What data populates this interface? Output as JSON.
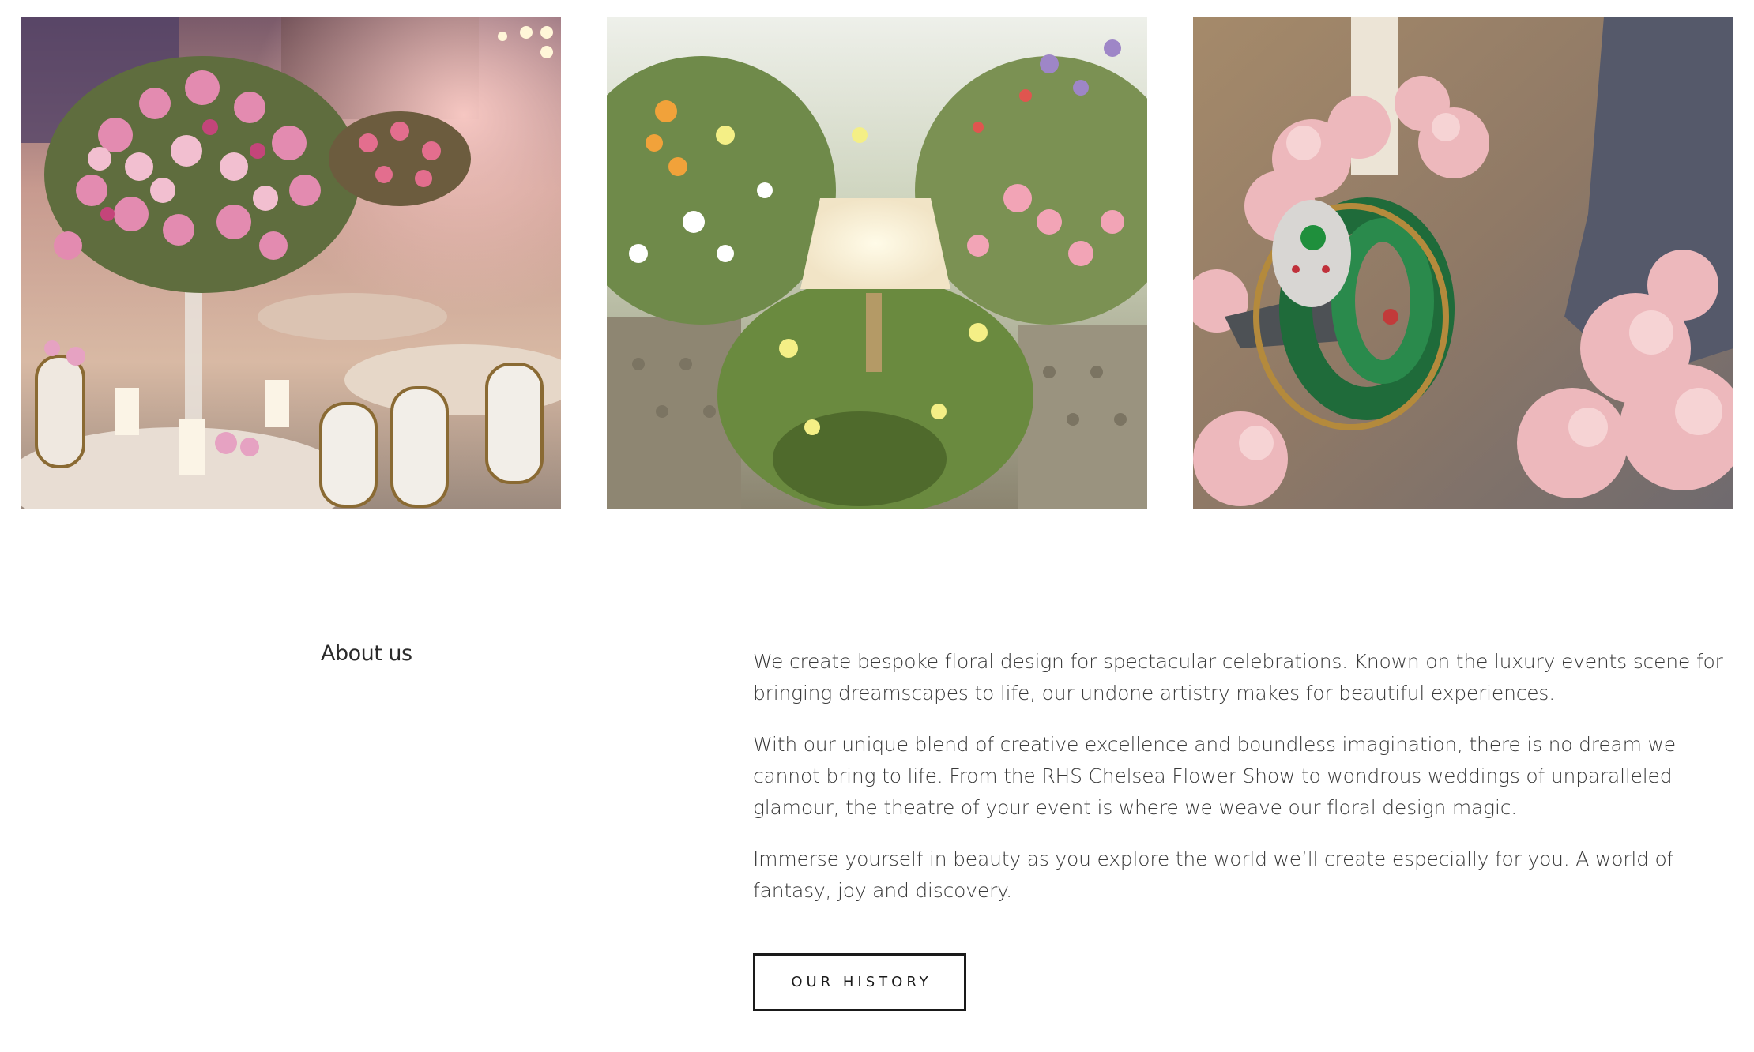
{
  "gallery": {
    "images": [
      {
        "subject": "pink-rose-table-centerpiece-ballroom"
      },
      {
        "subject": "wildflower-lamp-installation"
      },
      {
        "subject": "emerald-snake-jewellery-with-pink-lilac"
      }
    ]
  },
  "about": {
    "heading": "About us",
    "paragraphs": [
      "We create bespoke floral design for spectacular celebrations. Known on the luxury events scene for bringing dreamscapes to life, our undone artistry makes for beautiful experiences.",
      "With our unique blend of creative excellence and boundless imagination, there is no dream we cannot bring to life. From the RHS Chelsea Flower Show to wondrous weddings of unparalleled glamour, the theatre of your event is where we weave our floral design magic.",
      "Immerse yourself in beauty as you explore the world we’ll create especially for you. A world of fantasy, joy and discovery."
    ],
    "button_label": "OUR HISTORY"
  },
  "colors": {
    "background": "#ffffff",
    "text": "#333333",
    "button_border": "#1a1a1a"
  }
}
